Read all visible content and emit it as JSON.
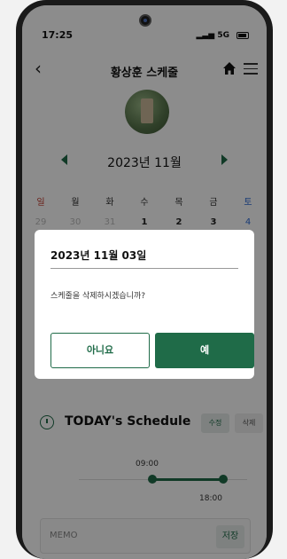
{
  "status_bar": {
    "time": "17:25",
    "network": "5G"
  },
  "header": {
    "title": "황상훈 스케줄"
  },
  "calendar": {
    "month_label": "2023년 11월",
    "weekdays": [
      "일",
      "월",
      "화",
      "수",
      "목",
      "금",
      "토"
    ],
    "dates": [
      "29",
      "30",
      "31",
      "1",
      "2",
      "3",
      "4"
    ]
  },
  "schedule": {
    "title": "TODAY's Schedule",
    "edit_label": "수정",
    "delete_label": "삭제",
    "start_time": "09:00",
    "end_time": "18:00"
  },
  "memo": {
    "placeholder": "MEMO",
    "save_label": "저장"
  },
  "dialog": {
    "date": "2023년 11월 03일",
    "message": "스케줄을 삭제하시겠습니까?",
    "no_label": "아니요",
    "yes_label": "예"
  },
  "colors": {
    "accent": "#1f6b48",
    "sunday": "#c0392b",
    "saturday": "#2e6bd6"
  }
}
